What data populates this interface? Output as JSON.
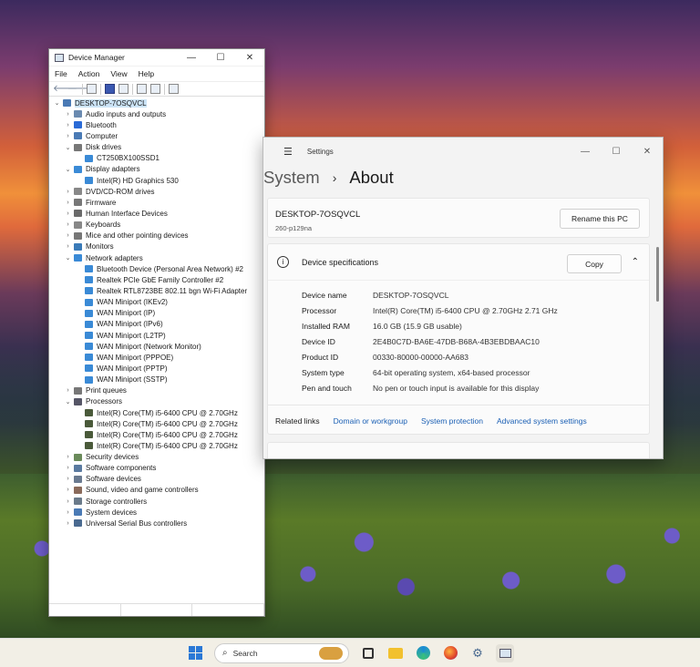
{
  "device_manager": {
    "title": "Device Manager",
    "menu": [
      "File",
      "Action",
      "View",
      "Help"
    ],
    "root": "DESKTOP-7OSQVCL",
    "categories": [
      {
        "label": "Audio inputs and outputs",
        "expanded": false
      },
      {
        "label": "Bluetooth",
        "expanded": false
      },
      {
        "label": "Computer",
        "expanded": false
      },
      {
        "label": "Disk drives",
        "expanded": true,
        "children": [
          "CT250BX100SSD1"
        ]
      },
      {
        "label": "Display adapters",
        "expanded": true,
        "children": [
          "Intel(R) HD Graphics 530"
        ]
      },
      {
        "label": "DVD/CD-ROM drives",
        "expanded": false
      },
      {
        "label": "Firmware",
        "expanded": false
      },
      {
        "label": "Human Interface Devices",
        "expanded": false
      },
      {
        "label": "Keyboards",
        "expanded": false
      },
      {
        "label": "Mice and other pointing devices",
        "expanded": false
      },
      {
        "label": "Monitors",
        "expanded": false
      },
      {
        "label": "Network adapters",
        "expanded": true,
        "children": [
          "Bluetooth Device (Personal Area Network) #2",
          "Realtek PCIe GbE Family Controller #2",
          "Realtek RTL8723BE 802.11 bgn Wi-Fi Adapter",
          "WAN Miniport (IKEv2)",
          "WAN Miniport (IP)",
          "WAN Miniport (IPv6)",
          "WAN Miniport (L2TP)",
          "WAN Miniport (Network Monitor)",
          "WAN Miniport (PPPOE)",
          "WAN Miniport (PPTP)",
          "WAN Miniport (SSTP)"
        ]
      },
      {
        "label": "Print queues",
        "expanded": false
      },
      {
        "label": "Processors",
        "expanded": true,
        "children": [
          "Intel(R) Core(TM) i5-6400 CPU @ 2.70GHz",
          "Intel(R) Core(TM) i5-6400 CPU @ 2.70GHz",
          "Intel(R) Core(TM) i5-6400 CPU @ 2.70GHz",
          "Intel(R) Core(TM) i5-6400 CPU @ 2.70GHz"
        ]
      },
      {
        "label": "Security devices",
        "expanded": false
      },
      {
        "label": "Software components",
        "expanded": false
      },
      {
        "label": "Software devices",
        "expanded": false
      },
      {
        "label": "Sound, video and game controllers",
        "expanded": false
      },
      {
        "label": "Storage controllers",
        "expanded": false
      },
      {
        "label": "System devices",
        "expanded": false
      },
      {
        "label": "Universal Serial Bus controllers",
        "expanded": false
      }
    ]
  },
  "settings": {
    "app_label": "Settings",
    "breadcrumb_parent": "System",
    "breadcrumb_current": "About",
    "pc_name": "DESKTOP-7OSQVCL",
    "pc_model": "260-p129na",
    "rename_label": "Rename this PC",
    "spec_header": "Device specifications",
    "copy_label": "Copy",
    "specs": [
      {
        "key": "Device name",
        "value": "DESKTOP-7OSQVCL"
      },
      {
        "key": "Processor",
        "value": "Intel(R) Core(TM) i5-6400 CPU @ 2.70GHz   2.71 GHz"
      },
      {
        "key": "Installed RAM",
        "value": "16.0 GB (15.9 GB usable)"
      },
      {
        "key": "Device ID",
        "value": "2E4B0C7D-BA6E-47DB-B68A-4B3EBDBAAC10"
      },
      {
        "key": "Product ID",
        "value": "00330-80000-00000-AA683"
      },
      {
        "key": "System type",
        "value": "64-bit operating system, x64-based processor"
      },
      {
        "key": "Pen and touch",
        "value": "No pen or touch input is available for this display"
      }
    ],
    "related_label": "Related links",
    "related_links": [
      "Domain or workgroup",
      "System protection",
      "Advanced system settings"
    ]
  },
  "taskbar": {
    "search_placeholder": "Search"
  },
  "icon_colors": {
    "accent": "#1a5fb4",
    "folder": "#f2c12e",
    "edge": "#1a8ad6"
  }
}
